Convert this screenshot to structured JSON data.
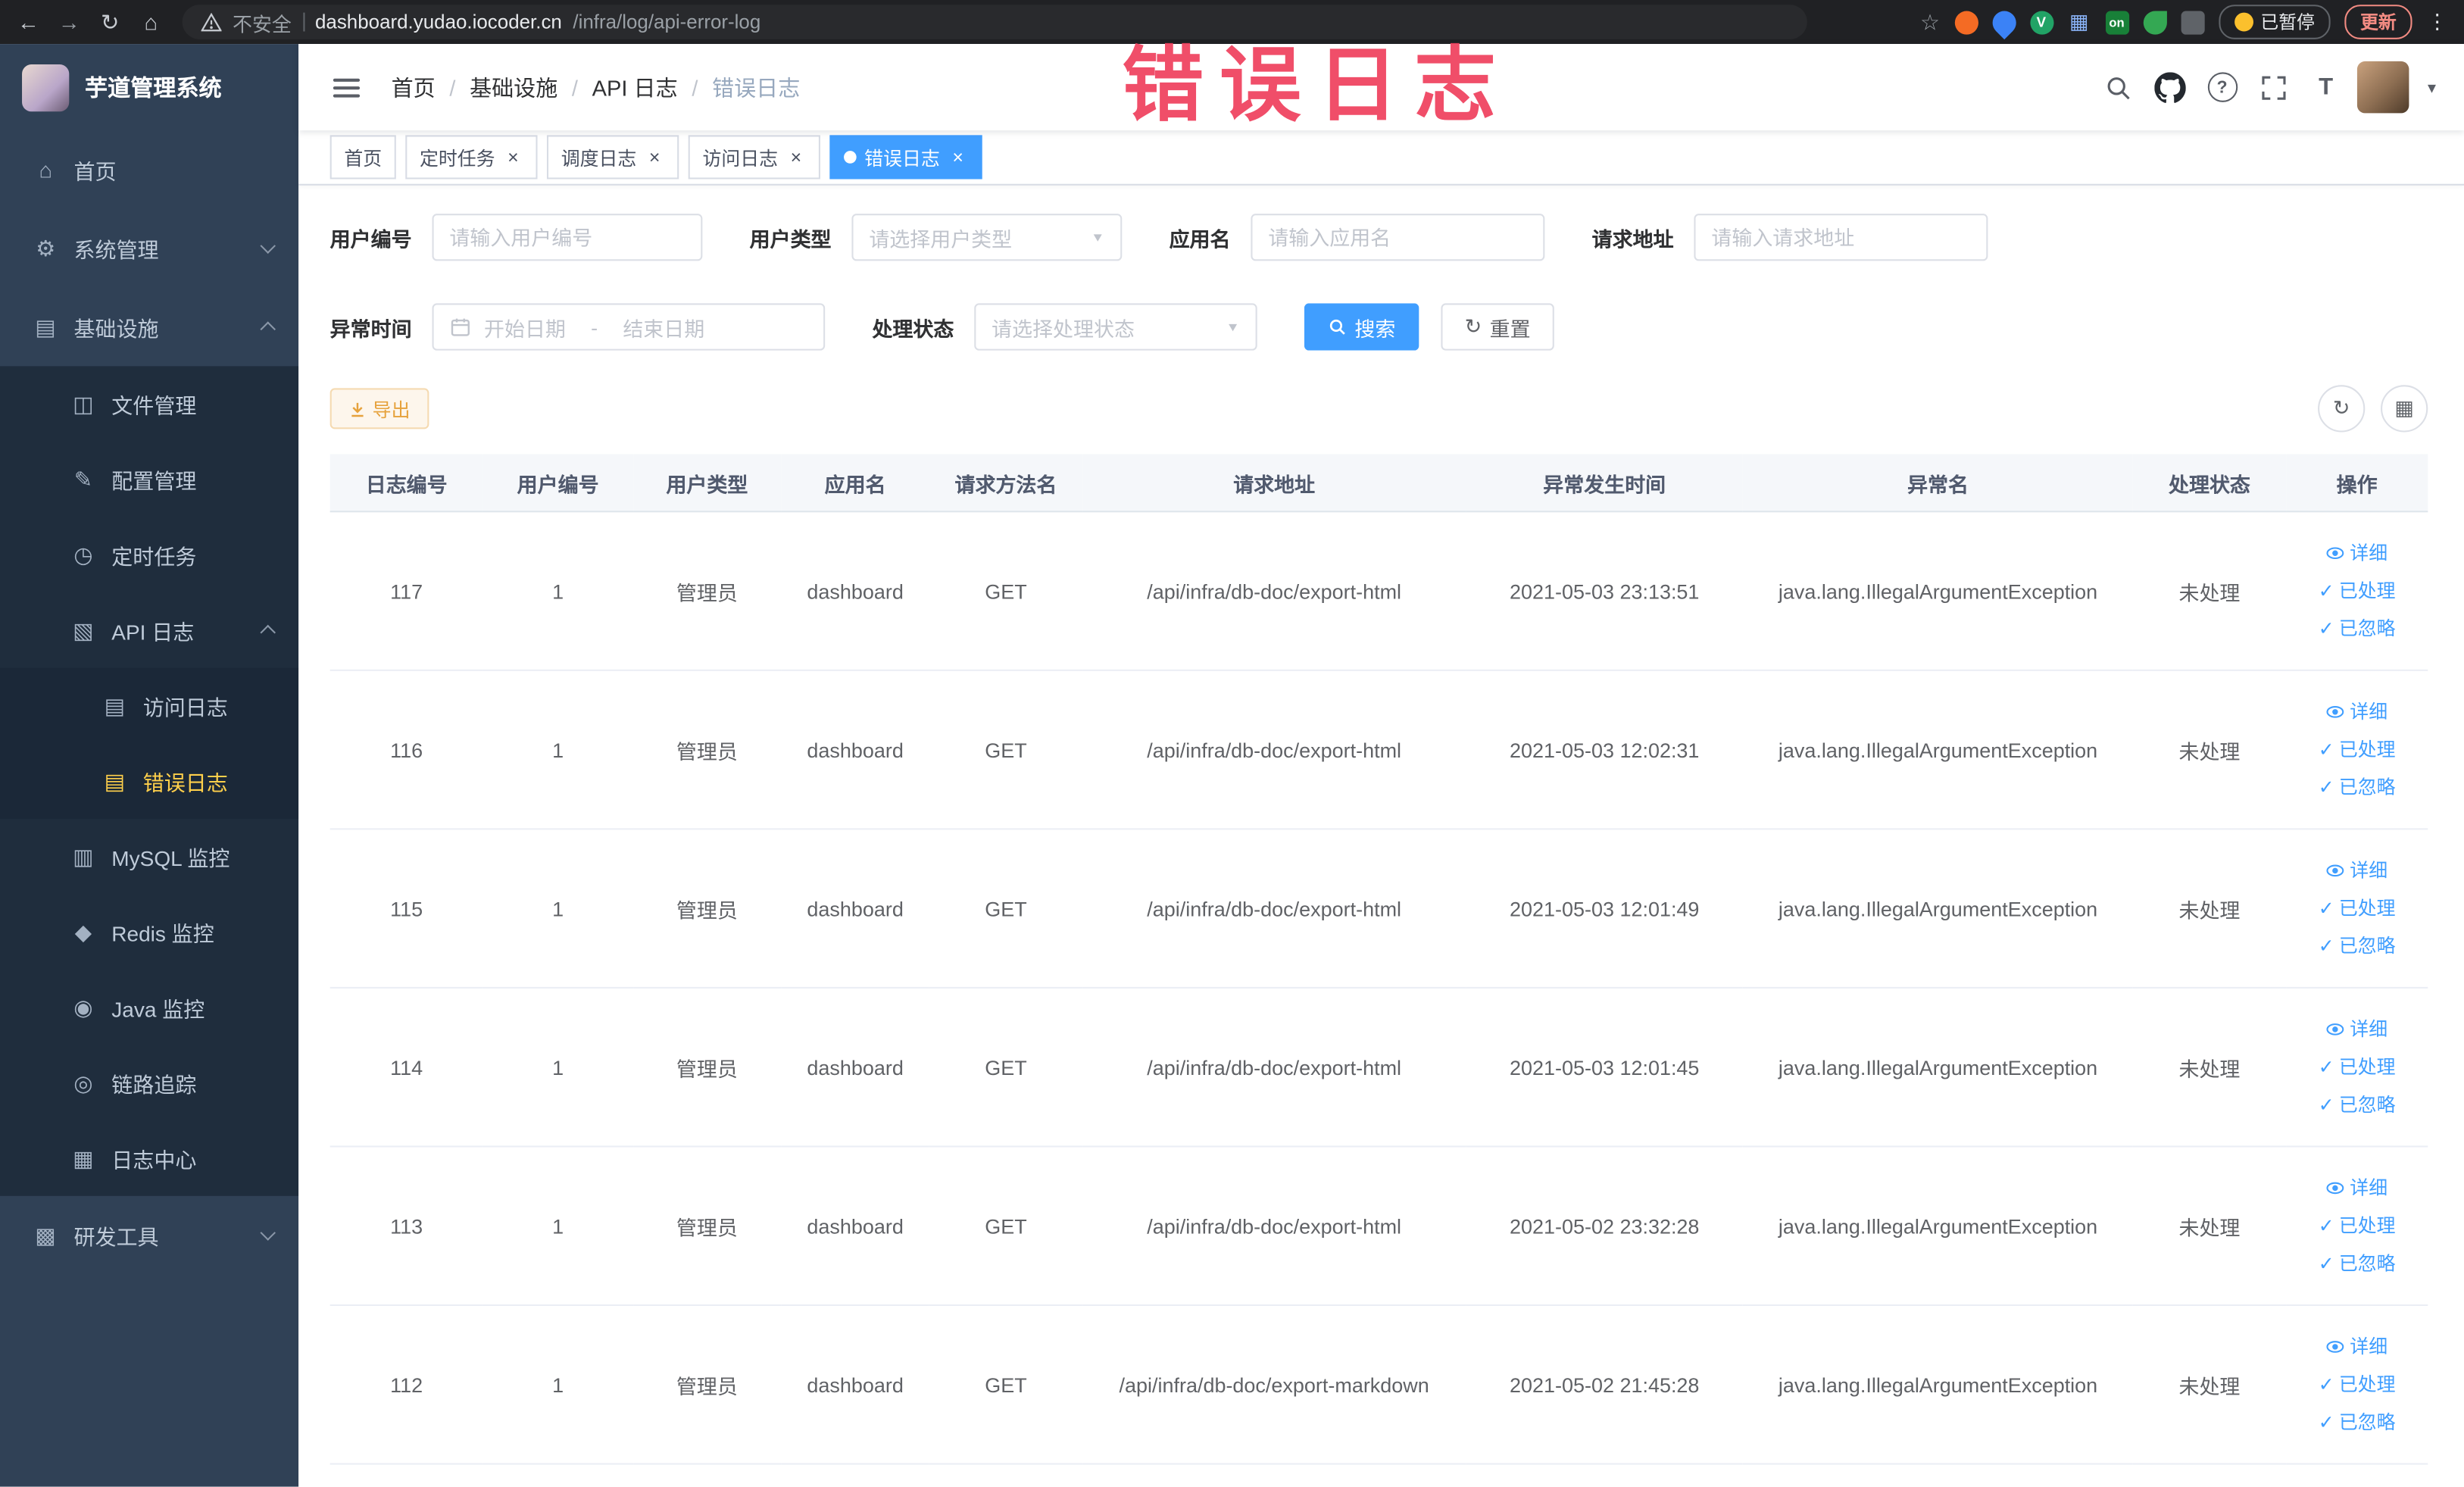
{
  "colors": {
    "accent": "#409EFF",
    "sidebar_active": "#FFD04B",
    "warning": "#E6A23C",
    "watermark": "#EF415E"
  },
  "browser": {
    "back_icon": "←",
    "forward_icon": "→",
    "reload_icon": "↻",
    "home_icon": "⌂",
    "security_label": "不安全",
    "url_host": "dashboard.yudao.iocoder.cn",
    "url_path": "/infra/log/api-error-log",
    "star_icon": "☆",
    "ext_v_label": "V",
    "ext_grid_icon": "▦",
    "ext_on_label": "on",
    "paused_label": "已暂停",
    "update_label": "更新",
    "menu_icon": "⋮"
  },
  "sidebar": {
    "logo_title": "芋道管理系统",
    "home": "首页",
    "system": "系统管理",
    "infra": "基础设施",
    "file": "文件管理",
    "config": "配置管理",
    "job": "定时任务",
    "apilog": "API 日志",
    "accesslog": "访问日志",
    "errorlog": "错误日志",
    "mysql": "MySQL 监控",
    "redis": "Redis 监控",
    "java": "Java 监控",
    "trace": "链路追踪",
    "logcenter": "日志中心",
    "devtools": "研发工具",
    "icons": {
      "home": "⌂",
      "system": "⚙",
      "infra": "▤",
      "file": "◫",
      "config": "✎",
      "job": "◷",
      "apilog": "▧",
      "accesslog": "▤",
      "errorlog": "▤",
      "mysql": "▥",
      "redis": "◆",
      "java": "◉",
      "trace": "◎",
      "logcenter": "▦",
      "devtools": "▩"
    }
  },
  "navbar": {
    "breadcrumb": [
      "首页",
      "基础设施",
      "API 日志",
      "错误日志"
    ],
    "sep": "/",
    "question_icon": "?",
    "fontsize_icon": "T",
    "caret_icon": "▼"
  },
  "tabs": {
    "items": [
      "首页",
      "定时任务",
      "调度日志",
      "访问日志",
      "错误日志"
    ],
    "close_icon": "×"
  },
  "watermark": "错误日志",
  "filters": {
    "user_id_label": "用户编号",
    "user_id_ph": "请输入用户编号",
    "user_type_label": "用户类型",
    "user_type_ph": "请选择用户类型",
    "app_name_label": "应用名",
    "app_name_ph": "请输入应用名",
    "req_url_label": "请求地址",
    "req_url_ph": "请输入请求地址",
    "time_label": "异常时间",
    "time_start_ph": "开始日期",
    "time_sep": "-",
    "time_end_ph": "结束日期",
    "status_label": "处理状态",
    "status_ph": "请选择处理状态",
    "search_label": "搜索",
    "reset_label": "重置",
    "reset_icon": "↻",
    "select_caret": "▼"
  },
  "toolbar": {
    "export_label": "导出",
    "refresh_icon": "↻",
    "columns_icon": "▦"
  },
  "table": {
    "headers": [
      "日志编号",
      "用户编号",
      "用户类型",
      "应用名",
      "请求方法名",
      "请求地址",
      "异常发生时间",
      "异常名",
      "处理状态",
      "操作"
    ],
    "actions": {
      "detail": "详细",
      "processed": "已处理",
      "ignored": "已忽略",
      "check_icon": "✓"
    },
    "rows": [
      {
        "id": "117",
        "user_id": "1",
        "user_type": "管理员",
        "app": "dashboard",
        "method": "GET",
        "url": "/api/infra/db-doc/export-html",
        "time": "2021-05-03 23:13:51",
        "exception": "java.lang.IllegalArgumentException",
        "status": "未处理"
      },
      {
        "id": "116",
        "user_id": "1",
        "user_type": "管理员",
        "app": "dashboard",
        "method": "GET",
        "url": "/api/infra/db-doc/export-html",
        "time": "2021-05-03 12:02:31",
        "exception": "java.lang.IllegalArgumentException",
        "status": "未处理"
      },
      {
        "id": "115",
        "user_id": "1",
        "user_type": "管理员",
        "app": "dashboard",
        "method": "GET",
        "url": "/api/infra/db-doc/export-html",
        "time": "2021-05-03 12:01:49",
        "exception": "java.lang.IllegalArgumentException",
        "status": "未处理"
      },
      {
        "id": "114",
        "user_id": "1",
        "user_type": "管理员",
        "app": "dashboard",
        "method": "GET",
        "url": "/api/infra/db-doc/export-html",
        "time": "2021-05-03 12:01:45",
        "exception": "java.lang.IllegalArgumentException",
        "status": "未处理"
      },
      {
        "id": "113",
        "user_id": "1",
        "user_type": "管理员",
        "app": "dashboard",
        "method": "GET",
        "url": "/api/infra/db-doc/export-html",
        "time": "2021-05-02 23:32:28",
        "exception": "java.lang.IllegalArgumentException",
        "status": "未处理"
      },
      {
        "id": "112",
        "user_id": "1",
        "user_type": "管理员",
        "app": "dashboard",
        "method": "GET",
        "url": "/api/infra/db-doc/export-markdown",
        "time": "2021-05-02 21:45:28",
        "exception": "java.lang.IllegalArgumentException",
        "status": "未处理"
      }
    ]
  }
}
